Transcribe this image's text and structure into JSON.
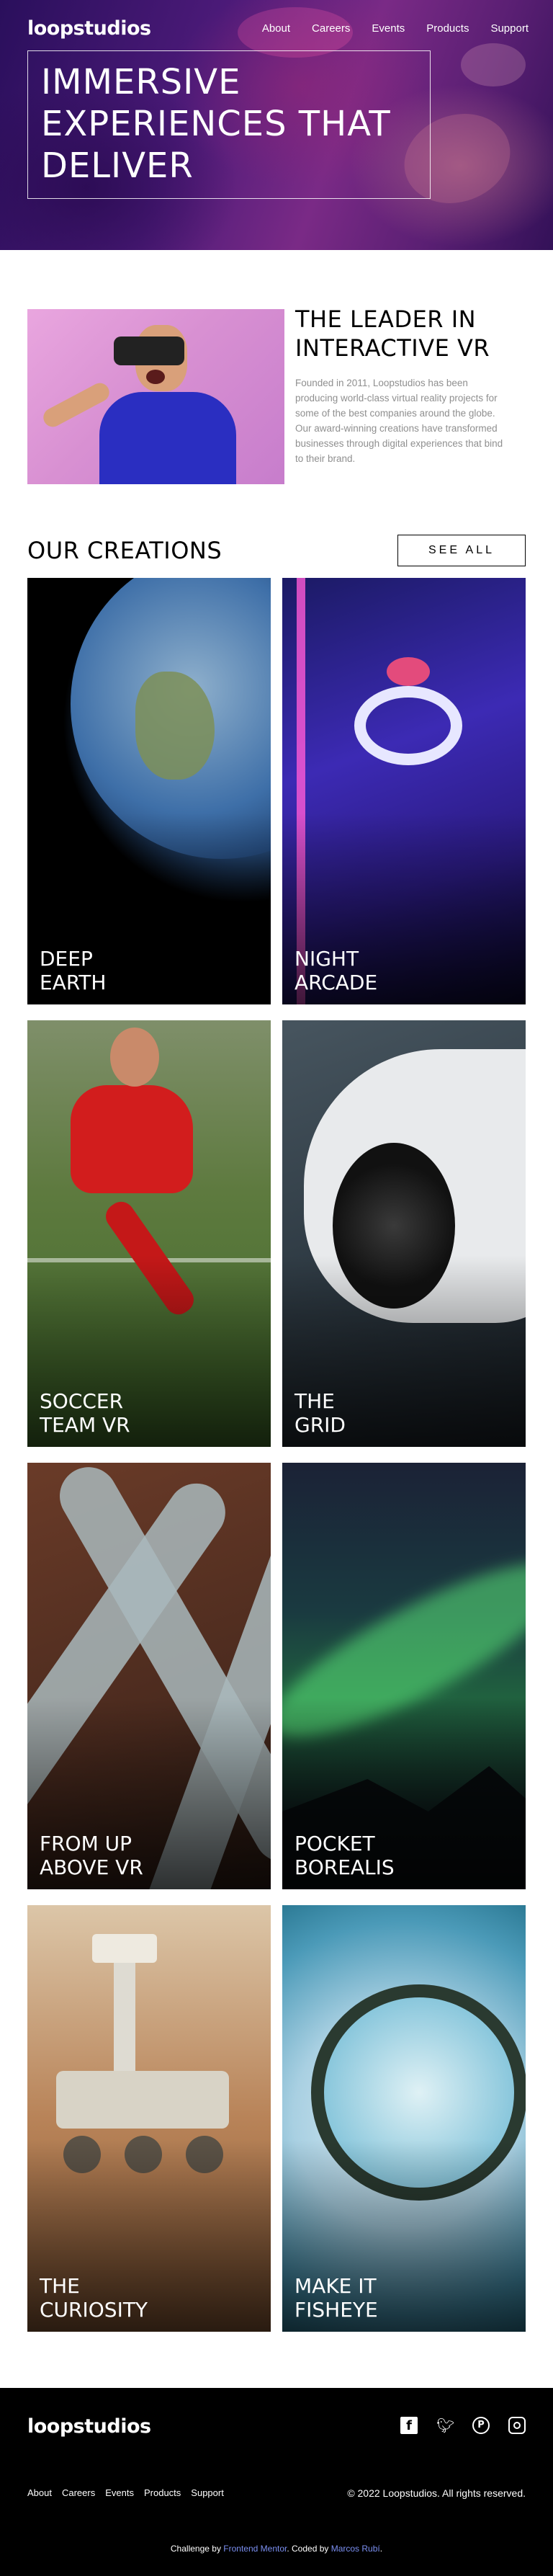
{
  "brand": {
    "logo": "loopstudios"
  },
  "nav": {
    "items": [
      "About",
      "Careers",
      "Events",
      "Products",
      "Support"
    ]
  },
  "hero": {
    "headline": "Immersive experiences that deliver"
  },
  "intro": {
    "title": "The leader in interactive VR",
    "body": "Founded in 2011, Loopstudios has been producing world-class virtual reality projects for some of the best companies around the globe. Our award-winning creations have transformed businesses through digital experiences that bind to their brand."
  },
  "creations": {
    "heading": "Our creations",
    "see_all_label": "See all",
    "items": [
      {
        "title": "Deep\nEarth"
      },
      {
        "title": "Night\nArcade"
      },
      {
        "title": "Soccer\nTeam VR"
      },
      {
        "title": "The\nGrid"
      },
      {
        "title": "From up\nabove VR"
      },
      {
        "title": "Pocket\nBorealis"
      },
      {
        "title": "The\nCuriosity"
      },
      {
        "title": "Make it\nfisheye"
      }
    ]
  },
  "footer": {
    "logo": "loopstudios",
    "social": [
      "facebook-icon",
      "twitter-icon",
      "pinterest-icon",
      "instagram-icon"
    ],
    "nav": [
      "About",
      "Careers",
      "Events",
      "Products",
      "Support"
    ],
    "copyright": "© 2022 Loopstudios. All rights reserved.",
    "attribution": {
      "prefix": "Challenge by ",
      "frontend_mentor": "Frontend Mentor",
      "middle": ". Coded by ",
      "author": "Marcos Rubí",
      "suffix": "."
    }
  },
  "colors": {
    "link_accent": "#7b8ff0",
    "footer_bg": "#000000",
    "muted_text": "#8f8f8f"
  }
}
